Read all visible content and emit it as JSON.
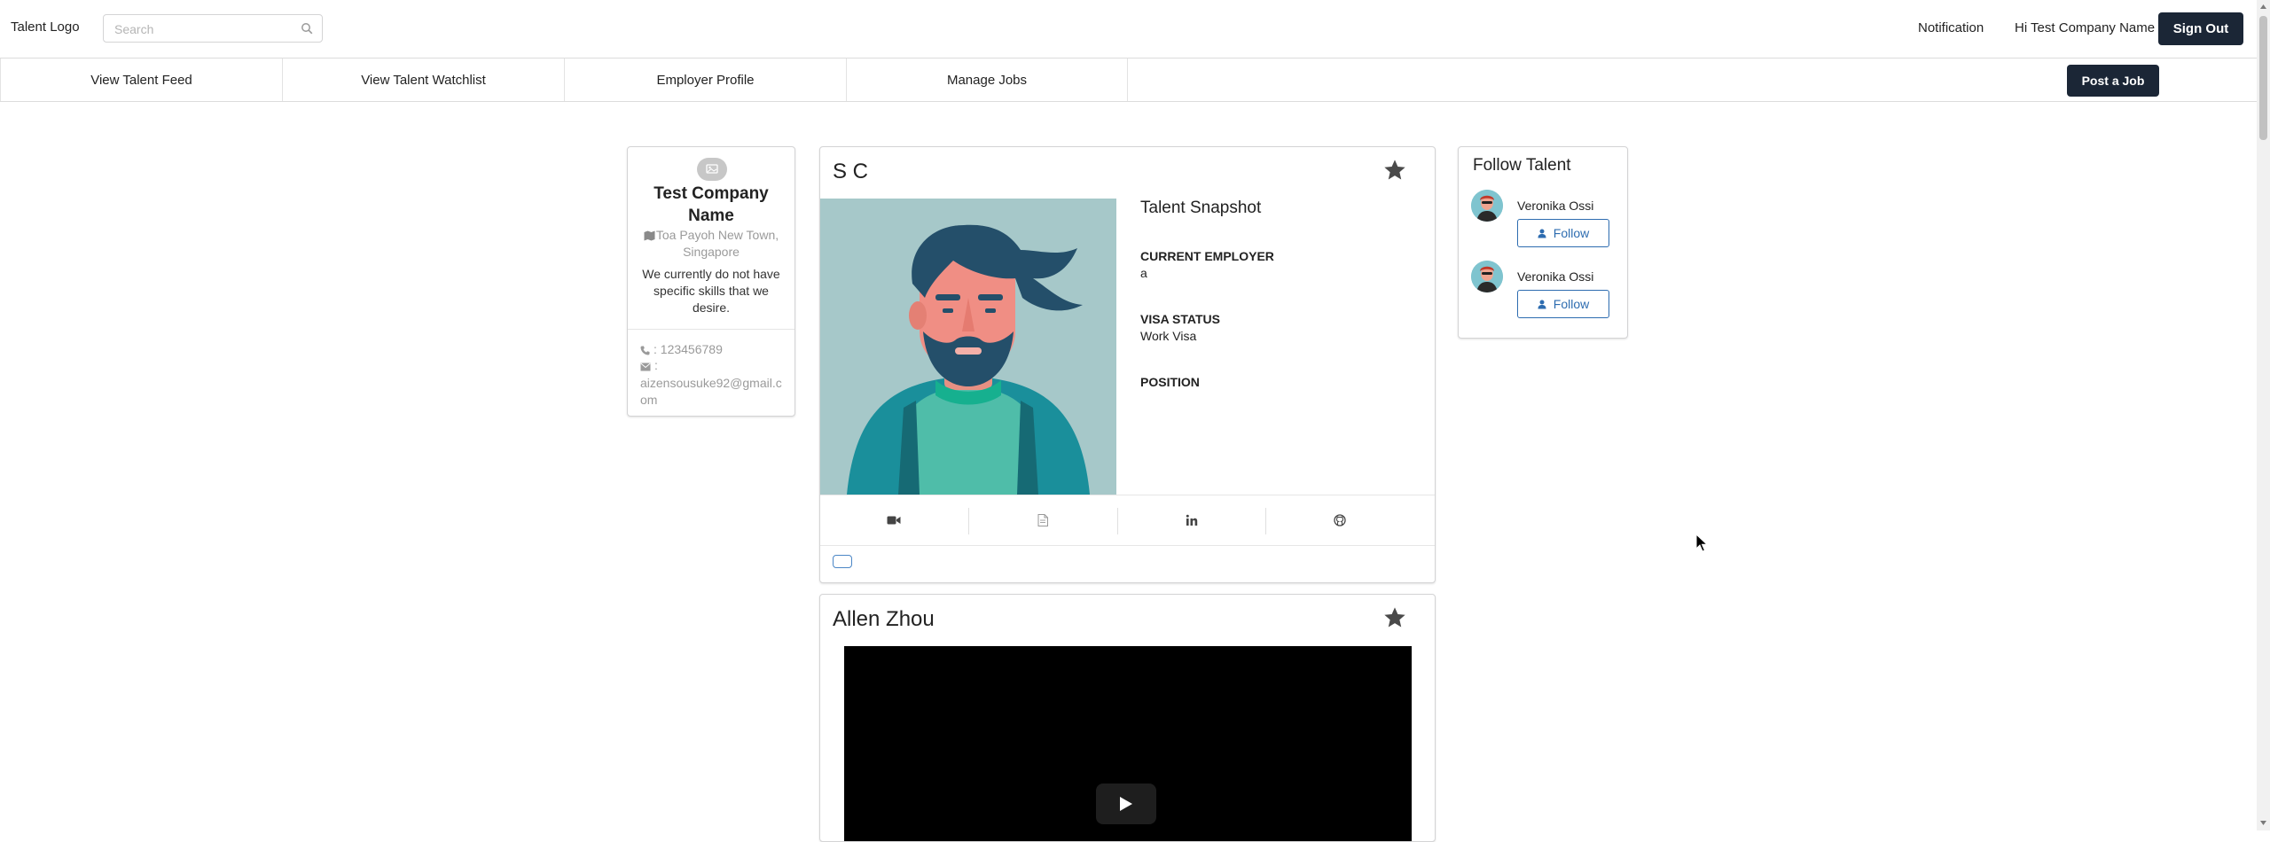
{
  "header": {
    "logo": "Talent Logo",
    "search_placeholder": "Search",
    "notification": "Notification",
    "greeting": "Hi Test Company Name",
    "sign_out": "Sign Out"
  },
  "nav": {
    "items": [
      {
        "label": "View Talent Feed"
      },
      {
        "label": "View Talent Watchlist"
      },
      {
        "label": "Employer Profile"
      },
      {
        "label": "Manage Jobs"
      }
    ],
    "post_job": "Post a Job"
  },
  "company": {
    "name": "Test Company Name",
    "location": "Toa Payoh New Town, Singapore",
    "description": "We currently do not have specific skills that we desire.",
    "phone": ": 123456789",
    "email_label": ":",
    "email": "aizensousuke92@gmail.com"
  },
  "talent_feed": [
    {
      "name": "S C",
      "snapshot_title": "Talent Snapshot",
      "current_employer_label": "CURRENT EMPLOYER",
      "current_employer": "a",
      "visa_status_label": "VISA STATUS",
      "visa_status": "Work Visa",
      "position_label": "POSITION",
      "position": ""
    },
    {
      "name": "Allen Zhou"
    }
  ],
  "follow_talent": {
    "title": "Follow Talent",
    "items": [
      {
        "name": "Veronika Ossi",
        "button": "Follow"
      },
      {
        "name": "Veronika Ossi",
        "button": "Follow"
      }
    ]
  },
  "colors": {
    "primary_dark": "#1b2636",
    "follow_blue": "#2d6cb0",
    "photo_bg": "#a6c8c9"
  },
  "icons": {
    "tools": [
      "video-camera-icon",
      "file-icon",
      "linkedin-icon",
      "github-icon"
    ]
  }
}
